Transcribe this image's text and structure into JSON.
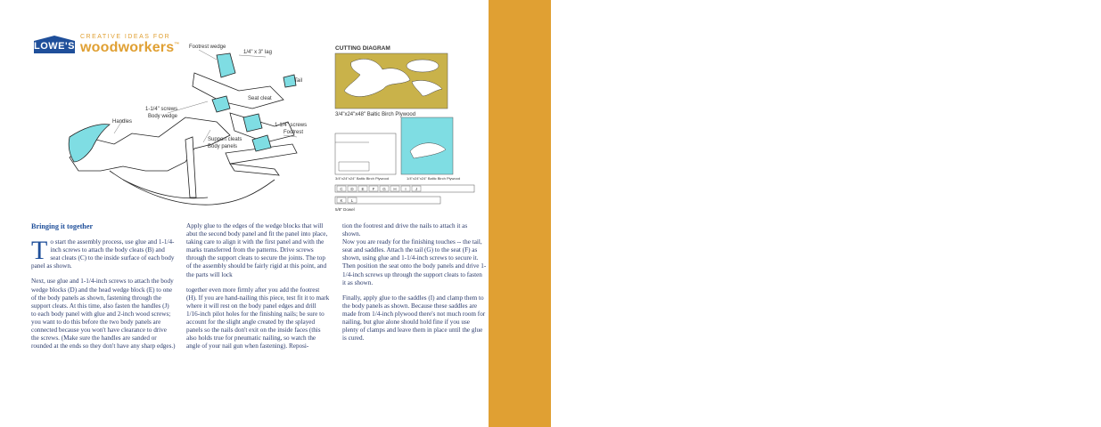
{
  "logo": {
    "badge": "LOWE'S",
    "tagline": "CREATIVE IDEAS FOR",
    "brand": "woodworkers",
    "tm": "™"
  },
  "assembly_labels": {
    "l1": "Footrest wedge",
    "l2": "1/4\" x 3\" lag",
    "l3": "1-1/4\" screws",
    "l4": "Seat cleat",
    "l5": "Handles",
    "l6": "Body wedge",
    "l7": "Support cleats",
    "l8": "1-1/4\" screws",
    "l9": "Tail",
    "l10": "Footrest",
    "l11": "Body panels"
  },
  "cutting": {
    "title": "CUTTING DIAGRAM",
    "sheet1_label": "3/4\"x24\"x48\" Baltic Birch Plywood",
    "sheet2_label": "3/4\"x24\"x24\" Baltic Birch Plywood",
    "sheet3_label": "1/4\"x24\"x24\" Baltic Birch Plywood",
    "dowel_label": "5/8\" Dowel",
    "parts_row": [
      "C",
      "D",
      "E",
      "F",
      "G",
      "H",
      "I",
      "J"
    ],
    "parts_row2": [
      "K",
      "L"
    ]
  },
  "text": {
    "heading": "Bringing it together",
    "dropcap": "T",
    "c1p1": "o start the assembly process, use glue and 1-1/4-inch screws to attach the body cleats (B) and seat cleats (C) to the inside surface of each body panel as shown.",
    "c1p2": "Next, use glue and 1-1/4-inch screws to attach the body wedge blocks (D) and the head wedge block (E) to one of the body panels as shown, fastening through the support cleats. At this time, also fasten the handles (J) to each body panel with glue and 2-inch wood screws; you want to do this before the two body panels are connected because you won't have clearance to drive the screws. (Make sure the handles are sanded or rounded at the ends so they don't have any sharp edges.)",
    "c2p1": "Apply glue to the edges of the wedge blocks that will abut the second body panel and fit the panel into place, taking care to align it with the first panel and with the marks transferred from the patterns. Drive screws through the support cleats to secure the joints. The top of the assembly should be fairly rigid at this point, and the parts will lock",
    "c2p2": "together even more firmly after you add the footrest (H). If you are hand-nailing this piece, test fit it to mark where it will rest on the body panel edges and drill 1/16-inch pilot holes for the finishing nails; be sure to account for the slight angle created by the splayed panels so the nails don't exit on the inside faces (this also holds true for pneumatic nailing, so watch the angle of your nail gun when fastening). Reposi-",
    "c3p1": "tion the footrest and drive the nails to attach it as shown.",
    "c3p2": "Now you are ready for the finishing touches -- the tail, seat and saddles. Attach the tail (G) to the seat (F) as shown, using glue and 1-1/4-inch screws to secure it. Then position the seat onto the body panels and drive 1-1/4-inch screws up through the support cleats to fasten it as shown.",
    "c3p3": "Finally, apply glue to the saddles (I) and clamp them to the body panels as shown. Because these saddles are made from 1/4-inch plywood there's not much room for nailing, but glue alone should hold fine if you use plenty of clamps and leave them in place until the glue is cured."
  },
  "colors": {
    "stripe": "#e0a033",
    "brand_blue": "#1f4f9a",
    "part_cyan": "#7fdde3",
    "plywood": "#c9b24a"
  }
}
